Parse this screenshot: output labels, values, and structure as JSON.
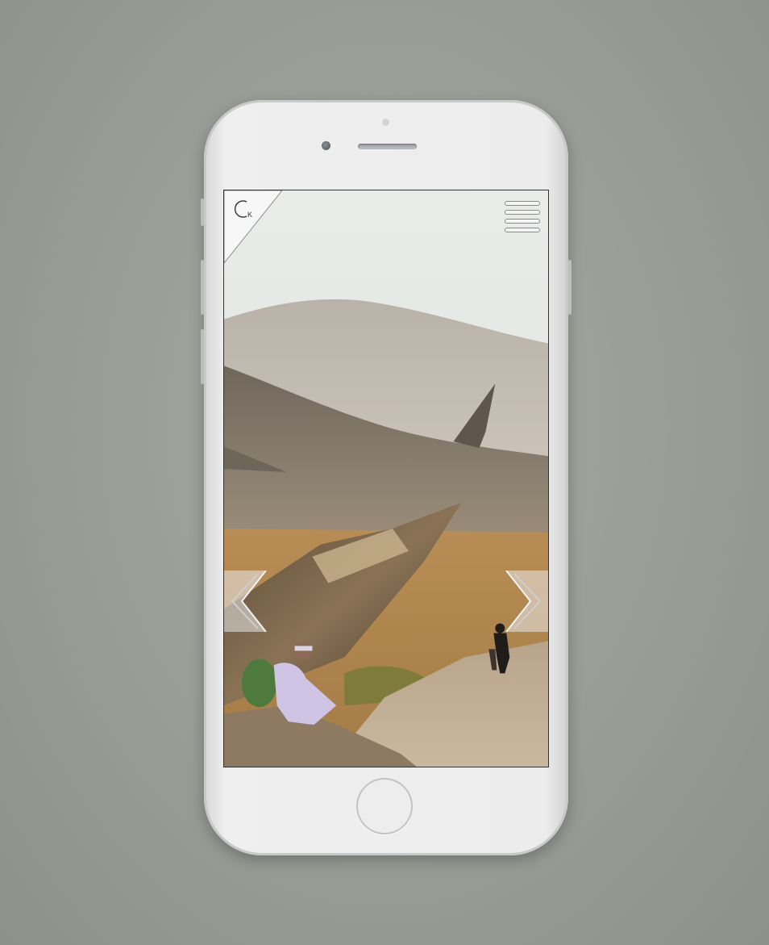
{
  "device": {
    "model": "smartphone",
    "color": "silver"
  },
  "app": {
    "logo": {
      "letters": "K",
      "icon": "ck-monogram-logo"
    },
    "menu": {
      "icon": "hamburger-menu-icon"
    },
    "carousel": {
      "prev_icon": "chevron-left-icon",
      "next_icon": "chevron-right-icon",
      "slide_image": "surreal-mountain-landscape-with-giant-pencils-and-hikers"
    }
  },
  "colors": {
    "background": "#9a9c96",
    "phone_body": "#ececec",
    "ui_white": "#f5f5f5"
  }
}
